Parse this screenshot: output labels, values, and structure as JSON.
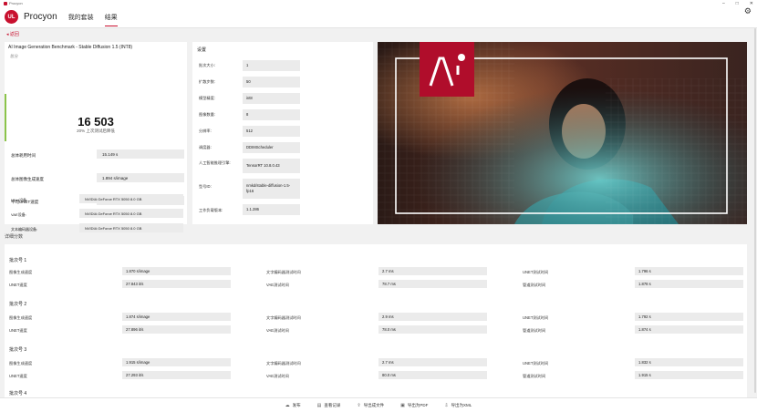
{
  "window": {
    "title": "Procyon"
  },
  "header": {
    "app_name": "Procyon",
    "logo_text": "UL",
    "tabs": [
      {
        "label": "我的套装"
      },
      {
        "label": "结果"
      }
    ]
  },
  "back": {
    "label": "返回"
  },
  "score": {
    "title": "AI Image Generation Benchmark - Stable Diffusion 1.5 (INT8)",
    "subtitle": "总分",
    "value": "16 503",
    "percentile": "20% 上次测试后降低",
    "metrics": [
      {
        "label": "总体耗用时间",
        "value": "15.149 s"
      },
      {
        "label": "总体图像生成速度",
        "value": "1.894 s/image"
      },
      {
        "label": "平均UNET速度",
        "value": "27.606 it/s"
      }
    ],
    "devices": [
      {
        "label": "文本编码器设备:",
        "value": "NVIDIA GeForce RTX 5050 8.0 GB"
      },
      {
        "label": "UNet设备:",
        "value": "NVIDIA GeForce RTX 5050 8.0 GB"
      },
      {
        "label": "VAE设备:",
        "value": "NVIDIA GeForce RTX 5050 8.0 GB"
      }
    ]
  },
  "settings": {
    "title": "设置",
    "rows": [
      {
        "label": "批次大小:",
        "value": "1"
      },
      {
        "label": "扩散步数:",
        "value": "50"
      },
      {
        "label": "模型精度:",
        "value": "int8"
      },
      {
        "label": "图像数量:",
        "value": "8"
      },
      {
        "label": "分辨率:",
        "value": "512"
      },
      {
        "label": "调度器:",
        "value": "DDIMScheduler"
      },
      {
        "label": "人工智能推理引擎:",
        "value": "TensorRT 10.8.0.43"
      },
      {
        "label": "型号ID:",
        "value": "nmkd/stable-diffusion-1.5-fp16"
      },
      {
        "label": "工作负载版本:",
        "value": "1.1.286"
      }
    ]
  },
  "details": {
    "label": "详细分数",
    "batches": [
      {
        "title": "批次号 1",
        "rows": [
          [
            {
              "label": "图像生成速度",
              "value": "1.870 s/image"
            },
            {
              "label": "文字编码器测试时间",
              "value": "2.7 ms"
            },
            {
              "label": "UNET测试时间",
              "value": "1.796 s"
            }
          ],
          [
            {
              "label": "UNET速度",
              "value": "27.843 it/s"
            },
            {
              "label": "VAE测试时间",
              "value": "78.7 ms"
            },
            {
              "label": "管道测试时间",
              "value": "1.878 s"
            }
          ]
        ]
      },
      {
        "title": "批次号 2",
        "rows": [
          [
            {
              "label": "图像生成速度",
              "value": "1.874 s/image"
            },
            {
              "label": "文字编码器测试时间",
              "value": "2.9 ms"
            },
            {
              "label": "UNET测试时间",
              "value": "1.792 s"
            }
          ],
          [
            {
              "label": "UNET速度",
              "value": "27.896 it/s"
            },
            {
              "label": "VAE测试时间",
              "value": "78.0 ms"
            },
            {
              "label": "管道测试时间",
              "value": "1.874 s"
            }
          ]
        ]
      },
      {
        "title": "批次号 3",
        "rows": [
          [
            {
              "label": "图像生成速度",
              "value": "1.915 s/image"
            },
            {
              "label": "文字编码器测试时间",
              "value": "2.7 ms"
            },
            {
              "label": "UNET测试时间",
              "value": "1.832 s"
            }
          ],
          [
            {
              "label": "UNET速度",
              "value": "27.293 it/s"
            },
            {
              "label": "VAE测试时间",
              "value": "80.0 ms"
            },
            {
              "label": "管道测试时间",
              "value": "1.915 s"
            }
          ]
        ]
      },
      {
        "title": "批次号 4",
        "rows": []
      }
    ]
  },
  "footer": {
    "buttons": [
      {
        "label": "发布",
        "icon": "cloud-icon"
      },
      {
        "label": "查看记录",
        "icon": "document-icon"
      },
      {
        "label": "导出成文件",
        "icon": "export-icon"
      },
      {
        "label": "导出为PDF",
        "icon": "pdf-icon"
      },
      {
        "label": "导出为XML",
        "icon": "xml-icon"
      }
    ]
  },
  "colors": {
    "accent": "#c8102e",
    "score_bar": "#8bc34a"
  }
}
